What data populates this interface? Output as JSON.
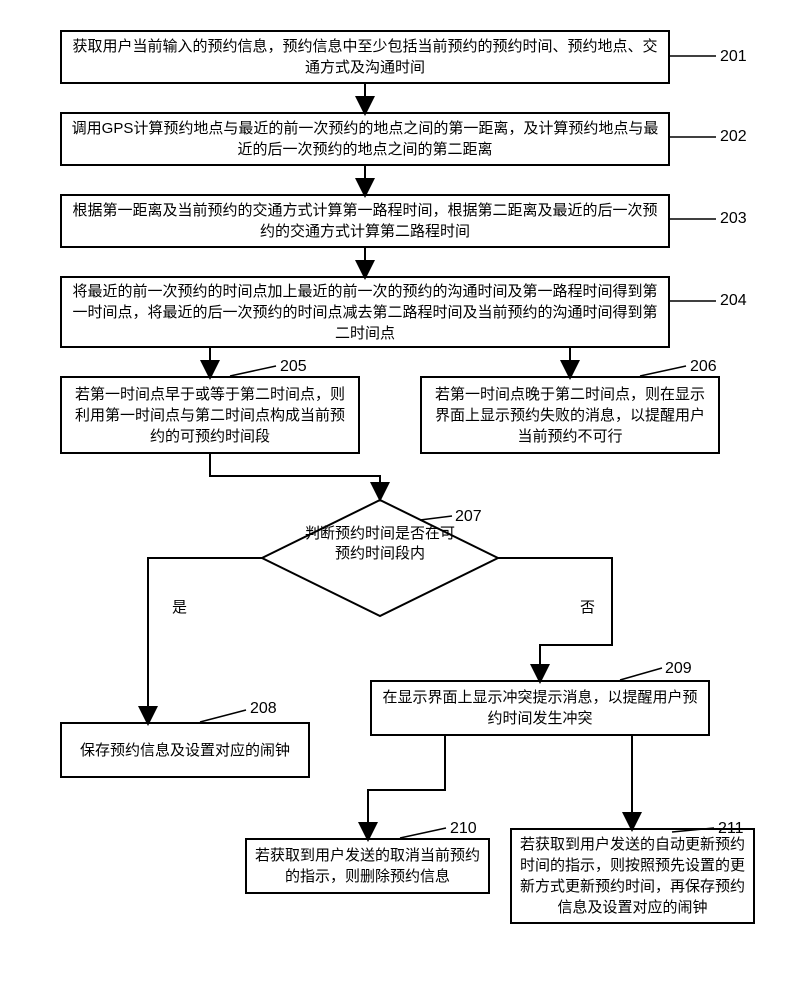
{
  "chart_data": {
    "type": "flowchart",
    "nodes": [
      {
        "id": "201",
        "shape": "rect",
        "text": "获取用户当前输入的预约信息，预约信息中至少包括当前预约的预约时间、预约地点、交通方式及沟通时间"
      },
      {
        "id": "202",
        "shape": "rect",
        "text": "调用GPS计算预约地点与最近的前一次预约的地点之间的第一距离，及计算预约地点与最近的后一次预约的地点之间的第二距离"
      },
      {
        "id": "203",
        "shape": "rect",
        "text": "根据第一距离及当前预约的交通方式计算第一路程时间，根据第二距离及最近的后一次预约的交通方式计算第二路程时间"
      },
      {
        "id": "204",
        "shape": "rect",
        "text": "将最近的前一次预约的时间点加上最近的前一次的预约的沟通时间及第一路程时间得到第一时间点，将最近的后一次预约的时间点减去第二路程时间及当前预约的沟通时间得到第二时间点"
      },
      {
        "id": "205",
        "shape": "rect",
        "text": "若第一时间点早于或等于第二时间点，则利用第一时间点与第二时间点构成当前预约的可预约时间段"
      },
      {
        "id": "206",
        "shape": "rect",
        "text": "若第一时间点晚于第二时间点，则在显示界面上显示预约失败的消息，以提醒用户当前预约不可行"
      },
      {
        "id": "207",
        "shape": "diamond",
        "text": "判断预约时间是否在可预约时间段内"
      },
      {
        "id": "208",
        "shape": "rect",
        "text": "保存预约信息及设置对应的闹钟"
      },
      {
        "id": "209",
        "shape": "rect",
        "text": "在显示界面上显示冲突提示消息，以提醒用户预约时间发生冲突"
      },
      {
        "id": "210",
        "shape": "rect",
        "text": "若获取到用户发送的取消当前预约的指示，则删除预约信息"
      },
      {
        "id": "211",
        "shape": "rect",
        "text": "若获取到用户发送的自动更新预约时间的指示，则按照预先设置的更新方式更新预约时间，再保存预约信息及设置对应的闹钟"
      }
    ],
    "edges": [
      {
        "from": "201",
        "to": "202"
      },
      {
        "from": "202",
        "to": "203"
      },
      {
        "from": "203",
        "to": "204"
      },
      {
        "from": "204",
        "to": "205"
      },
      {
        "from": "204",
        "to": "206"
      },
      {
        "from": "205",
        "to": "207"
      },
      {
        "from": "207",
        "to": "208",
        "label": "是"
      },
      {
        "from": "207",
        "to": "209",
        "label": "否"
      },
      {
        "from": "209",
        "to": "210"
      },
      {
        "from": "209",
        "to": "211"
      }
    ]
  },
  "labels": {
    "n201": "201",
    "n202": "202",
    "n203": "203",
    "n204": "204",
    "n205": "205",
    "n206": "206",
    "n207": "207",
    "n208": "208",
    "n209": "209",
    "n210": "210",
    "n211": "211",
    "yes": "是",
    "no": "否"
  },
  "texts": {
    "t201": "获取用户当前输入的预约信息，预约信息中至少包括当前预约的预约时间、预约地点、交通方式及沟通时间",
    "t202": "调用GPS计算预约地点与最近的前一次预约的地点之间的第一距离，及计算预约地点与最近的后一次预约的地点之间的第二距离",
    "t203": "根据第一距离及当前预约的交通方式计算第一路程时间，根据第二距离及最近的后一次预约的交通方式计算第二路程时间",
    "t204": "将最近的前一次预约的时间点加上最近的前一次的预约的沟通时间及第一路程时间得到第一时间点，将最近的后一次预约的时间点减去第二路程时间及当前预约的沟通时间得到第二时间点",
    "t205": "若第一时间点早于或等于第二时间点，则利用第一时间点与第二时间点构成当前预约的可预约时间段",
    "t206": "若第一时间点晚于第二时间点，则在显示界面上显示预约失败的消息，以提醒用户当前预约不可行",
    "t207": "判断预约时间是否在可预约时间段内",
    "t208": "保存预约信息及设置对应的闹钟",
    "t209": "在显示界面上显示冲突提示消息，以提醒用户预约时间发生冲突",
    "t210": "若获取到用户发送的取消当前预约的指示，则删除预约信息",
    "t211": "若获取到用户发送的自动更新预约时间的指示，则按照预先设置的更新方式更新预约时间，再保存预约信息及设置对应的闹钟"
  }
}
